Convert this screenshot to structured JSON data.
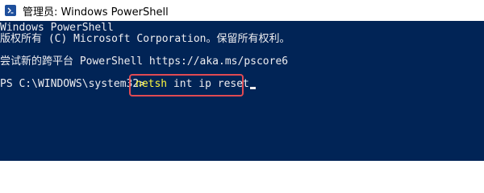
{
  "window": {
    "title": "管理员: Windows PowerShell",
    "icon": "powershell-icon"
  },
  "console": {
    "lines": [
      "Windows PowerShell",
      "版权所有 (C) Microsoft Corporation。保留所有权利。",
      "尝试新的跨平台 PowerShell https://aka.ms/pscore6"
    ],
    "prompt": "PS C:\\WINDOWS\\system32>",
    "command_name": "netsh",
    "command_args": " int ip reset"
  },
  "colors": {
    "console_bg": "#012456",
    "text": "#eeedf0",
    "command": "#fdf53e",
    "highlight_border": "#e14a52"
  }
}
